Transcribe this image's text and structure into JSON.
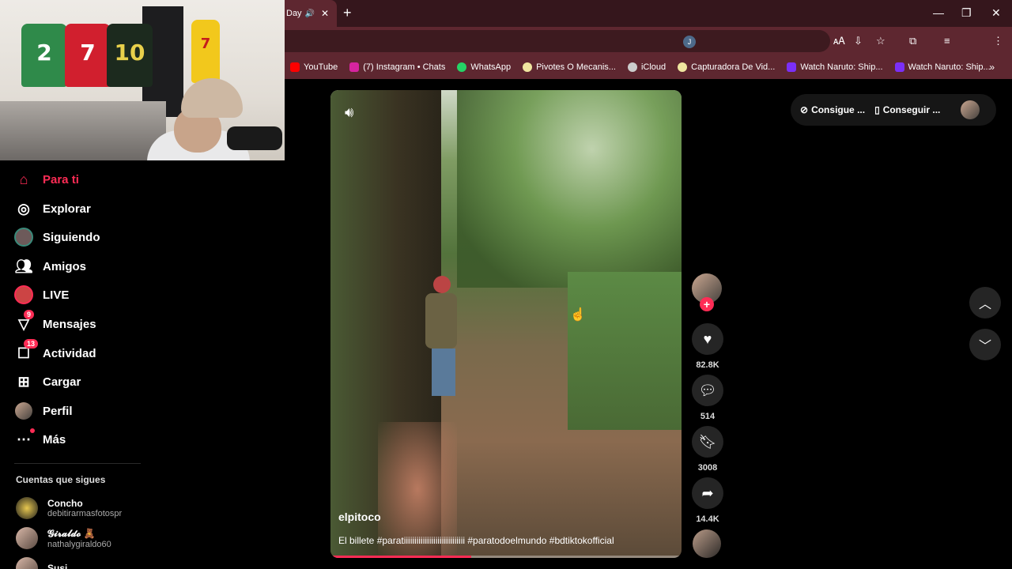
{
  "browser": {
    "active_tab_title": "Day",
    "tab_sound_icon": "speaker-icon",
    "tab_close": "✕",
    "new_tab": "+",
    "window": {
      "minimize": "—",
      "maximize": "❐",
      "close": "✕"
    },
    "profile_initial": "J",
    "bookmarks": [
      {
        "label": "YouTube",
        "color": "#ff0000"
      },
      {
        "label": "(7) Instagram • Chats",
        "color": "#d6249f"
      },
      {
        "label": "WhatsApp",
        "color": "#25d366"
      },
      {
        "label": "Pivotes O Mecanis...",
        "color": "#f0e6a0"
      },
      {
        "label": "iCloud",
        "color": "#cccccc"
      },
      {
        "label": "Capturadora De Vid...",
        "color": "#f0e6a0"
      },
      {
        "label": "Watch Naruto: Ship...",
        "color": "#7b2ff7"
      },
      {
        "label": "Watch Naruto: Ship...",
        "color": "#7b2ff7"
      }
    ],
    "bookmarks_more": "»"
  },
  "sidebar": {
    "nav": [
      {
        "label": "Para ti",
        "icon": "home-icon",
        "active": true
      },
      {
        "label": "Explorar",
        "icon": "compass-icon"
      },
      {
        "label": "Siguiendo",
        "icon": "following-avatar"
      },
      {
        "label": "Amigos",
        "icon": "friends-icon"
      },
      {
        "label": "LIVE",
        "icon": "live-icon"
      },
      {
        "label": "Mensajes",
        "icon": "messages-icon",
        "badge": "9"
      },
      {
        "label": "Actividad",
        "icon": "activity-icon",
        "badge": "13"
      },
      {
        "label": "Cargar",
        "icon": "upload-icon"
      },
      {
        "label": "Perfil",
        "icon": "profile-avatar"
      },
      {
        "label": "Más",
        "icon": "more-icon"
      }
    ],
    "following_title": "Cuentas que sigues",
    "accounts": [
      {
        "name": "Concho",
        "user": "debitirarmasfotospr"
      },
      {
        "name": "𝓖𝓲𝓻𝓪𝓵𝓭𝓸 🧸",
        "user": "nathalygiraldo60"
      },
      {
        "name": "Susi",
        "user": ""
      }
    ]
  },
  "video": {
    "author": "elpitoco",
    "caption": "El billete #paratiiiiiiiiiiiiiiiiiiiiiiiiiiiii #paratodoelmundo #bdtiktokofficial",
    "progress": 0.4
  },
  "actions": {
    "likes": "82.8K",
    "comments": "514",
    "saves": "3008",
    "shares": "14.4K"
  },
  "topright": {
    "pill1": "Consigue ...",
    "pill2": "Conseguir ..."
  },
  "colors": {
    "accent": "#fe2c55",
    "chrome": "#5e2730",
    "tabbar": "#35161c"
  }
}
